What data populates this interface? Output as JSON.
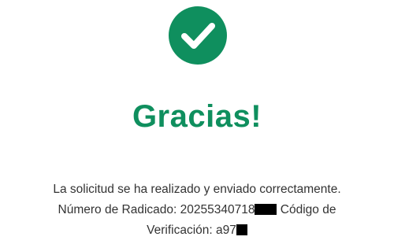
{
  "colors": {
    "brand_green": "#0f8f5e",
    "text": "#333333",
    "background": "#ffffff",
    "redaction": "#000000"
  },
  "success_icon": "check-icon",
  "title": "Gracias!",
  "message": {
    "line1": "La solicitud se ha realizado y enviado correctamente.",
    "radicado_label": "Número de Radicado:",
    "radicado_value": "20255340718",
    "codigo_label": "Código de",
    "verificacion_label": "Verificación:",
    "verificacion_value": "a97"
  }
}
